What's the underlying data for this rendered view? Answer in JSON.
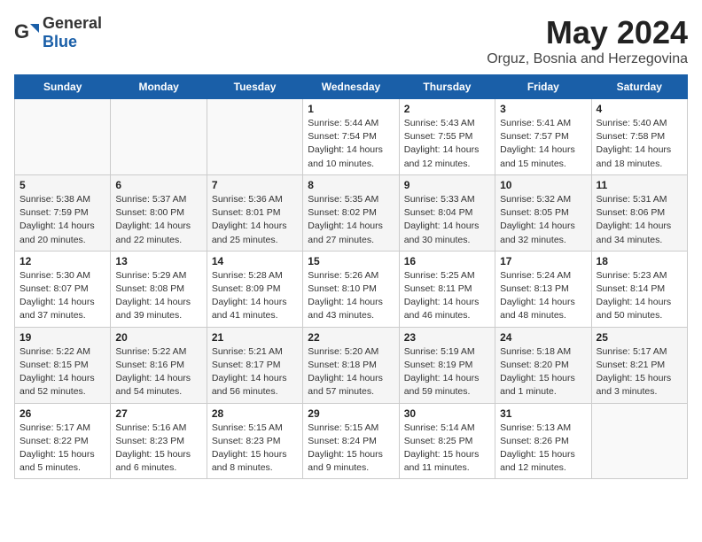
{
  "logo": {
    "text_general": "General",
    "text_blue": "Blue"
  },
  "title": "May 2024",
  "subtitle": "Orguz, Bosnia and Herzegovina",
  "days_of_week": [
    "Sunday",
    "Monday",
    "Tuesday",
    "Wednesday",
    "Thursday",
    "Friday",
    "Saturday"
  ],
  "weeks": [
    [
      {
        "num": "",
        "info": ""
      },
      {
        "num": "",
        "info": ""
      },
      {
        "num": "",
        "info": ""
      },
      {
        "num": "1",
        "info": "Sunrise: 5:44 AM\nSunset: 7:54 PM\nDaylight: 14 hours\nand 10 minutes."
      },
      {
        "num": "2",
        "info": "Sunrise: 5:43 AM\nSunset: 7:55 PM\nDaylight: 14 hours\nand 12 minutes."
      },
      {
        "num": "3",
        "info": "Sunrise: 5:41 AM\nSunset: 7:57 PM\nDaylight: 14 hours\nand 15 minutes."
      },
      {
        "num": "4",
        "info": "Sunrise: 5:40 AM\nSunset: 7:58 PM\nDaylight: 14 hours\nand 18 minutes."
      }
    ],
    [
      {
        "num": "5",
        "info": "Sunrise: 5:38 AM\nSunset: 7:59 PM\nDaylight: 14 hours\nand 20 minutes."
      },
      {
        "num": "6",
        "info": "Sunrise: 5:37 AM\nSunset: 8:00 PM\nDaylight: 14 hours\nand 22 minutes."
      },
      {
        "num": "7",
        "info": "Sunrise: 5:36 AM\nSunset: 8:01 PM\nDaylight: 14 hours\nand 25 minutes."
      },
      {
        "num": "8",
        "info": "Sunrise: 5:35 AM\nSunset: 8:02 PM\nDaylight: 14 hours\nand 27 minutes."
      },
      {
        "num": "9",
        "info": "Sunrise: 5:33 AM\nSunset: 8:04 PM\nDaylight: 14 hours\nand 30 minutes."
      },
      {
        "num": "10",
        "info": "Sunrise: 5:32 AM\nSunset: 8:05 PM\nDaylight: 14 hours\nand 32 minutes."
      },
      {
        "num": "11",
        "info": "Sunrise: 5:31 AM\nSunset: 8:06 PM\nDaylight: 14 hours\nand 34 minutes."
      }
    ],
    [
      {
        "num": "12",
        "info": "Sunrise: 5:30 AM\nSunset: 8:07 PM\nDaylight: 14 hours\nand 37 minutes."
      },
      {
        "num": "13",
        "info": "Sunrise: 5:29 AM\nSunset: 8:08 PM\nDaylight: 14 hours\nand 39 minutes."
      },
      {
        "num": "14",
        "info": "Sunrise: 5:28 AM\nSunset: 8:09 PM\nDaylight: 14 hours\nand 41 minutes."
      },
      {
        "num": "15",
        "info": "Sunrise: 5:26 AM\nSunset: 8:10 PM\nDaylight: 14 hours\nand 43 minutes."
      },
      {
        "num": "16",
        "info": "Sunrise: 5:25 AM\nSunset: 8:11 PM\nDaylight: 14 hours\nand 46 minutes."
      },
      {
        "num": "17",
        "info": "Sunrise: 5:24 AM\nSunset: 8:13 PM\nDaylight: 14 hours\nand 48 minutes."
      },
      {
        "num": "18",
        "info": "Sunrise: 5:23 AM\nSunset: 8:14 PM\nDaylight: 14 hours\nand 50 minutes."
      }
    ],
    [
      {
        "num": "19",
        "info": "Sunrise: 5:22 AM\nSunset: 8:15 PM\nDaylight: 14 hours\nand 52 minutes."
      },
      {
        "num": "20",
        "info": "Sunrise: 5:22 AM\nSunset: 8:16 PM\nDaylight: 14 hours\nand 54 minutes."
      },
      {
        "num": "21",
        "info": "Sunrise: 5:21 AM\nSunset: 8:17 PM\nDaylight: 14 hours\nand 56 minutes."
      },
      {
        "num": "22",
        "info": "Sunrise: 5:20 AM\nSunset: 8:18 PM\nDaylight: 14 hours\nand 57 minutes."
      },
      {
        "num": "23",
        "info": "Sunrise: 5:19 AM\nSunset: 8:19 PM\nDaylight: 14 hours\nand 59 minutes."
      },
      {
        "num": "24",
        "info": "Sunrise: 5:18 AM\nSunset: 8:20 PM\nDaylight: 15 hours\nand 1 minute."
      },
      {
        "num": "25",
        "info": "Sunrise: 5:17 AM\nSunset: 8:21 PM\nDaylight: 15 hours\nand 3 minutes."
      }
    ],
    [
      {
        "num": "26",
        "info": "Sunrise: 5:17 AM\nSunset: 8:22 PM\nDaylight: 15 hours\nand 5 minutes."
      },
      {
        "num": "27",
        "info": "Sunrise: 5:16 AM\nSunset: 8:23 PM\nDaylight: 15 hours\nand 6 minutes."
      },
      {
        "num": "28",
        "info": "Sunrise: 5:15 AM\nSunset: 8:23 PM\nDaylight: 15 hours\nand 8 minutes."
      },
      {
        "num": "29",
        "info": "Sunrise: 5:15 AM\nSunset: 8:24 PM\nDaylight: 15 hours\nand 9 minutes."
      },
      {
        "num": "30",
        "info": "Sunrise: 5:14 AM\nSunset: 8:25 PM\nDaylight: 15 hours\nand 11 minutes."
      },
      {
        "num": "31",
        "info": "Sunrise: 5:13 AM\nSunset: 8:26 PM\nDaylight: 15 hours\nand 12 minutes."
      },
      {
        "num": "",
        "info": ""
      }
    ]
  ]
}
